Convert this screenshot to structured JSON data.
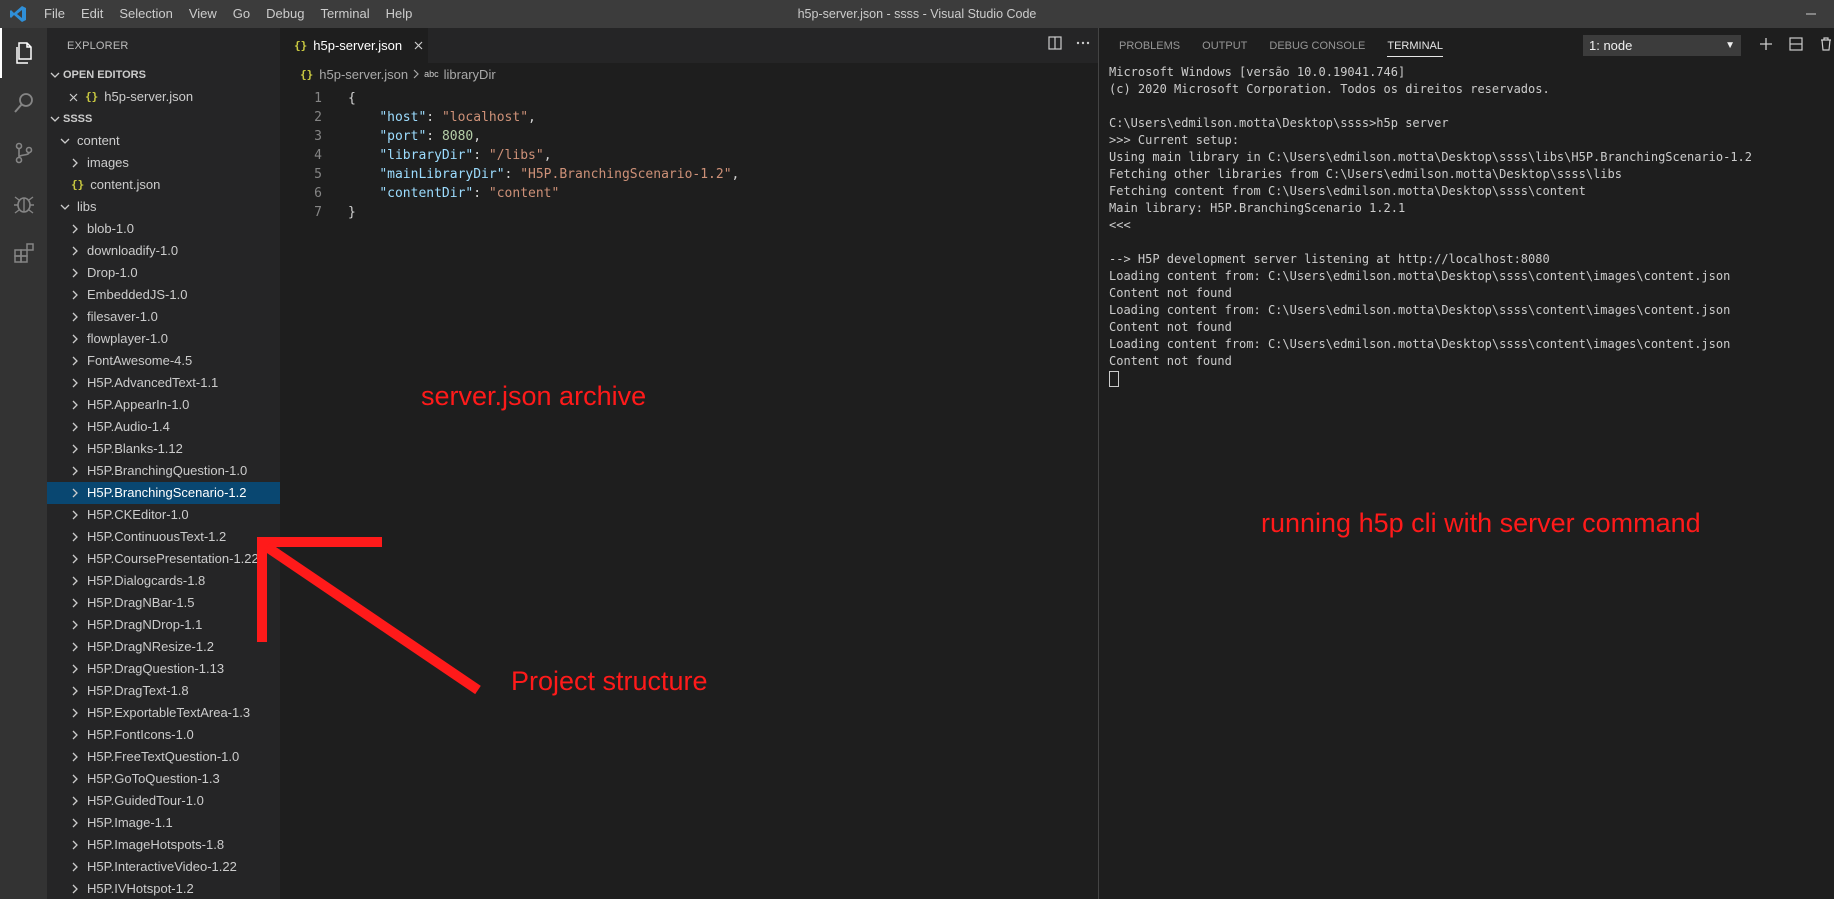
{
  "titlebar": {
    "menu": [
      "File",
      "Edit",
      "Selection",
      "View",
      "Go",
      "Debug",
      "Terminal",
      "Help"
    ],
    "title": "h5p-server.json - ssss - Visual Studio Code"
  },
  "activitybar": {
    "icons": [
      "files-icon",
      "search-icon",
      "source-control-icon",
      "debug-icon",
      "extensions-icon"
    ]
  },
  "sidebar": {
    "header": "EXPLORER",
    "open_editors": {
      "label": "OPEN EDITORS",
      "file": "h5p-server.json"
    },
    "project": {
      "label": "SSSS",
      "content_folder": "content",
      "images_folder": "images",
      "content_json": "content.json",
      "libs_folder": "libs",
      "libs": [
        "blob-1.0",
        "downloadify-1.0",
        "Drop-1.0",
        "EmbeddedJS-1.0",
        "filesaver-1.0",
        "flowplayer-1.0",
        "FontAwesome-4.5",
        "H5P.AdvancedText-1.1",
        "H5P.AppearIn-1.0",
        "H5P.Audio-1.4",
        "H5P.Blanks-1.12",
        "H5P.BranchingQuestion-1.0",
        "H5P.BranchingScenario-1.2",
        "H5P.CKEditor-1.0",
        "H5P.ContinuousText-1.2",
        "H5P.CoursePresentation-1.22",
        "H5P.Dialogcards-1.8",
        "H5P.DragNBar-1.5",
        "H5P.DragNDrop-1.1",
        "H5P.DragNResize-1.2",
        "H5P.DragQuestion-1.13",
        "H5P.DragText-1.8",
        "H5P.ExportableTextArea-1.3",
        "H5P.FontIcons-1.0",
        "H5P.FreeTextQuestion-1.0",
        "H5P.GoToQuestion-1.3",
        "H5P.GuidedTour-1.0",
        "H5P.Image-1.1",
        "H5P.ImageHotspots-1.8",
        "H5P.InteractiveVideo-1.22",
        "H5P.IVHotspot-1.2"
      ],
      "selected_lib": "H5P.BranchingScenario-1.2"
    }
  },
  "editor": {
    "tab": "h5p-server.json",
    "breadcrumb": {
      "file": "h5p-server.json",
      "symbol": "libraryDir"
    },
    "lines": [
      {
        "num": "1",
        "key": "",
        "value": "",
        "text": "{"
      },
      {
        "num": "2",
        "key": "\"host\"",
        "value": "\"localhost\"",
        "text": ""
      },
      {
        "num": "3",
        "key": "\"port\"",
        "value": "8080",
        "text": ""
      },
      {
        "num": "4",
        "key": "\"libraryDir\"",
        "value": "\"/libs\"",
        "text": ""
      },
      {
        "num": "5",
        "key": "\"mainLibraryDir\"",
        "value": "\"H5P.BranchingScenario-1.2\"",
        "text": ""
      },
      {
        "num": "6",
        "key": "\"contentDir\"",
        "value": "\"content\"",
        "text": ""
      },
      {
        "num": "7",
        "key": "",
        "value": "",
        "text": "}"
      }
    ]
  },
  "panel": {
    "tabs": [
      "PROBLEMS",
      "OUTPUT",
      "DEBUG CONSOLE",
      "TERMINAL"
    ],
    "active_tab": "TERMINAL",
    "terminal_select": "1: node",
    "terminal_lines": [
      "Microsoft Windows [versão 10.0.19041.746]",
      "(c) 2020 Microsoft Corporation. Todos os direitos reservados.",
      "",
      "C:\\Users\\edmilson.motta\\Desktop\\ssss>h5p server",
      ">>> Current setup:",
      "Using main library in C:\\Users\\edmilson.motta\\Desktop\\ssss\\libs\\H5P.BranchingScenario-1.2",
      "Fetching other libraries from C:\\Users\\edmilson.motta\\Desktop\\ssss\\libs",
      "Fetching content from C:\\Users\\edmilson.motta\\Desktop\\ssss\\content",
      "Main library: H5P.BranchingScenario 1.2.1",
      "<<<",
      "",
      "--> H5P development server listening at http://localhost:8080",
      "Loading content from: C:\\Users\\edmilson.motta\\Desktop\\ssss\\content\\images\\content.json",
      "Content not found",
      "Loading content from: C:\\Users\\edmilson.motta\\Desktop\\ssss\\content\\images\\content.json",
      "Content not found",
      "Loading content from: C:\\Users\\edmilson.motta\\Desktop\\ssss\\content\\images\\content.json",
      "Content not found"
    ]
  },
  "annotations": {
    "server_json": "server.json archive",
    "project_structure": "Project structure",
    "running": "running h5p cli with server command",
    "color": "#ff1a1a"
  },
  "colors": {
    "titlebar": "#3c3c3c",
    "activitybar": "#333333",
    "sidebar": "#252526",
    "editor": "#1e1e1e",
    "selection": "#094771",
    "json_key": "#9cdcfe",
    "json_string": "#ce9178",
    "json_number": "#b5cea8"
  }
}
